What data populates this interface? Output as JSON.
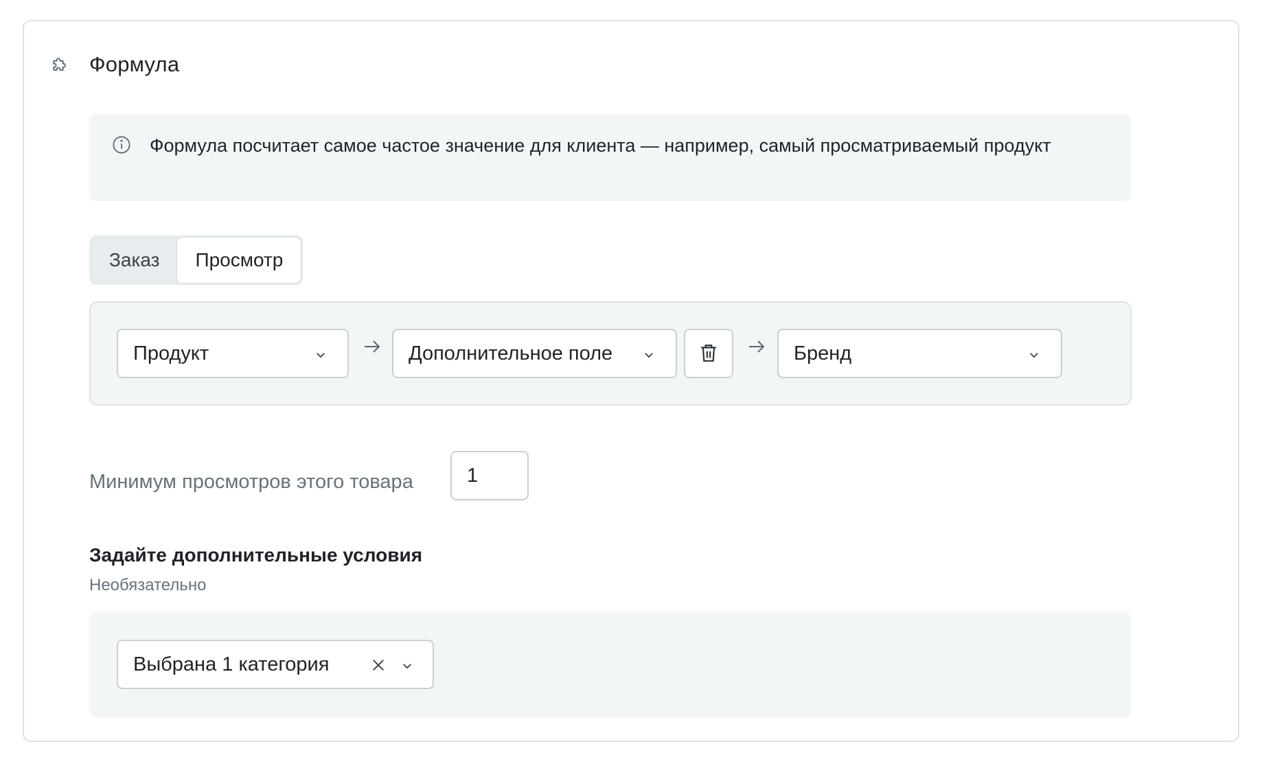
{
  "header": {
    "title": "Формула",
    "icon": "puzzle-icon"
  },
  "info": {
    "icon": "info-icon",
    "text": "Формула посчитает самое частое значение для клиента — например, самый просматриваемый продукт"
  },
  "tabs": [
    {
      "label": "Заказ",
      "active": false
    },
    {
      "label": "Просмотр",
      "active": true
    }
  ],
  "path": {
    "first_select": "Продукт",
    "second_select": "Дополнительное поле",
    "third_select": "Бренд",
    "arrow_icon": "arrow-right-icon",
    "delete_icon": "trash-icon"
  },
  "min_views": {
    "label": "Минимум просмотров этого товара",
    "value": "1"
  },
  "conditions": {
    "title": "Задайте дополнительные условия",
    "subtitle": "Необязательно",
    "category_select": "Выбрана 1 категория"
  },
  "colors": {
    "panel_bg": "#f2f6f7",
    "border": "#c9d0d5",
    "muted_text": "#66727b",
    "text": "#1f2328"
  }
}
